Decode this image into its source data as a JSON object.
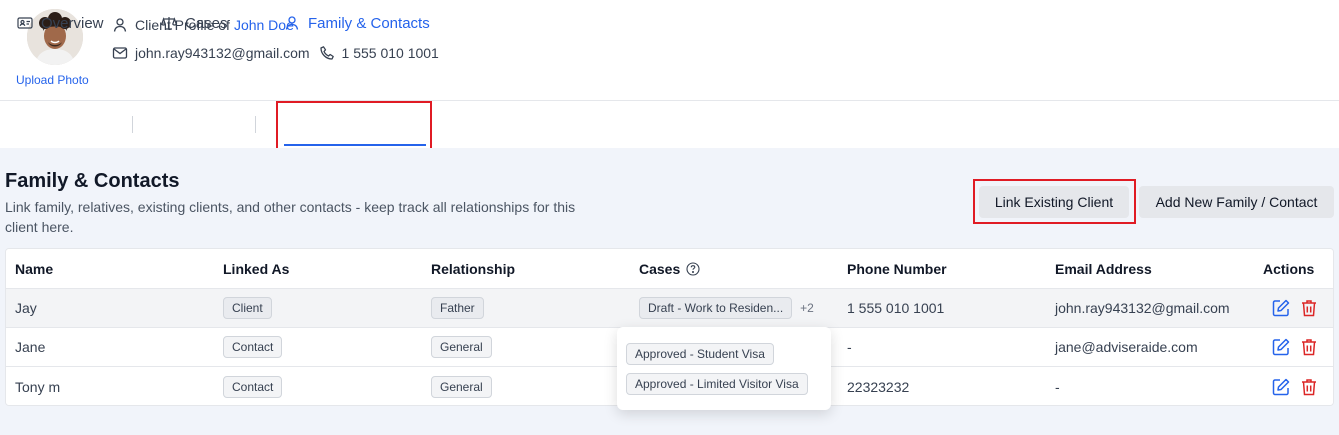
{
  "header": {
    "upload_photo": "Upload Photo",
    "profile_label": "Client Profile of",
    "client_name": "John Doe",
    "email": "john.ray943132@gmail.com",
    "phone": "1 555 010 1001"
  },
  "tabs": [
    {
      "label": "Overview",
      "icon": "id-card-icon"
    },
    {
      "label": "Cases",
      "icon": "scale-icon"
    },
    {
      "label": "Family & Contacts",
      "icon": "user-icon",
      "active": true
    }
  ],
  "section": {
    "title": "Family & Contacts",
    "subtitle": "Link family, relatives, existing clients, and other contacts - keep track all relationships for this client here.",
    "link_button": "Link Existing Client",
    "add_button": "Add New Family / Contact"
  },
  "table": {
    "columns": [
      "Name",
      "Linked As",
      "Relationship",
      "Cases",
      "Phone Number",
      "Email Address",
      "Actions"
    ],
    "rows": [
      {
        "name": "Jay",
        "linked_as": "Client",
        "relationship": "Father",
        "case": "Draft - Work to Residen...",
        "more": "+2",
        "phone": "1 555 010 1001",
        "email": "john.ray943132@gmail.com"
      },
      {
        "name": "Jane",
        "linked_as": "Contact",
        "relationship": "General",
        "case": "",
        "more": "",
        "phone": "-",
        "email": "jane@adviseraide.com"
      },
      {
        "name": "Tony m",
        "linked_as": "Contact",
        "relationship": "General",
        "case": "",
        "more": "",
        "phone": "22323232",
        "email": "-"
      }
    ]
  },
  "popover": {
    "cases": [
      "Approved - Student Visa",
      "Approved - Limited Visitor Visa"
    ]
  },
  "colors": {
    "accent": "#2563eb",
    "highlight": "#e01b24",
    "delete": "#dc2626",
    "content_bg": "#f1f4fa"
  }
}
